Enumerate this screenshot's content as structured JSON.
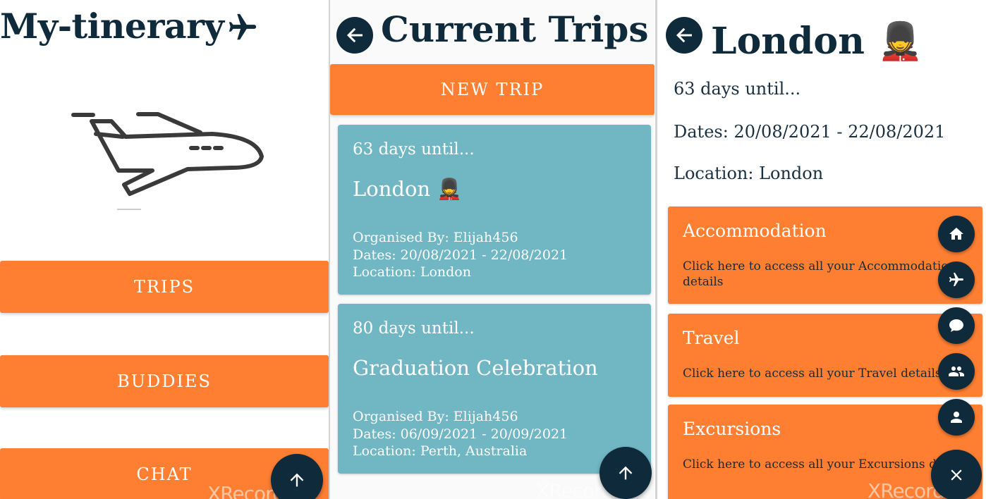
{
  "panel_home": {
    "app_title": "My-tinerary",
    "buttons": {
      "trips": "TRIPS",
      "buddies": "BUDDIES",
      "chat": "CHAT"
    },
    "watermark": "XRecorder"
  },
  "panel_trips": {
    "title": "Current Trips",
    "new_trip_label": "NEW TRIP",
    "trips": [
      {
        "countdown": "63 days until...",
        "name": "London 💂",
        "organiser": "Organised By: Elijah456",
        "dates": "Dates: 20/08/2021 - 22/08/2021",
        "location": "Location: London"
      },
      {
        "countdown": "80 days until...",
        "name": "Graduation Celebration",
        "organiser": "Organised By: Elijah456",
        "dates": "Dates: 06/09/2021 - 20/09/2021",
        "location": "Location: Perth, Australia"
      }
    ],
    "watermark": "XRecorder"
  },
  "panel_trip_detail": {
    "title": "London 💂",
    "countdown": "63 days until...",
    "dates": "Dates: 20/08/2021 - 22/08/2021",
    "location": "Location: London",
    "categories": [
      {
        "title": "Accommodation",
        "description": "Click here to access all your Accommodation details"
      },
      {
        "title": "Travel",
        "description": "Click here to access all your Travel details"
      },
      {
        "title": "Excursions",
        "description": "Click here to access all your Excursions details"
      }
    ],
    "fab_menu": [
      "home-icon",
      "airplane-icon",
      "chat-icon",
      "group-icon",
      "person-icon",
      "close-icon"
    ],
    "watermark": "XRecorder"
  },
  "colors": {
    "navy": "#0f2a3a",
    "orange": "#ff7f32",
    "card_teal": "#71b6c3"
  }
}
